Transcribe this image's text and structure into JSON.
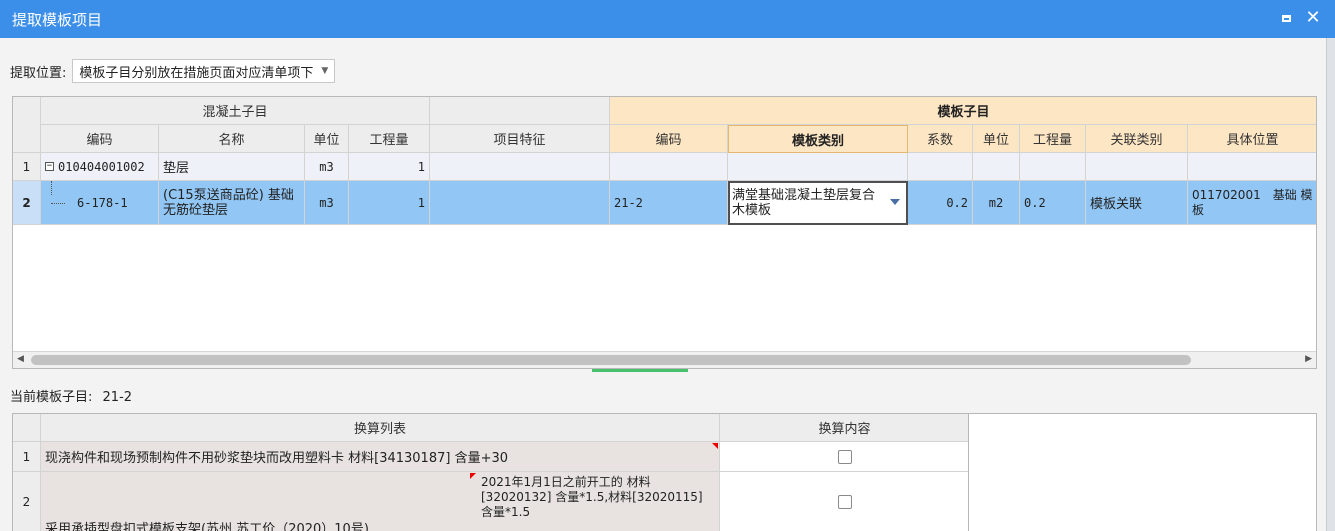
{
  "window": {
    "title": "提取模板项目"
  },
  "position": {
    "label": "提取位置:",
    "selected": "模板子目分别放在措施页面对应清单项下"
  },
  "top_grid": {
    "group_left": "混凝土子目",
    "group_right": "模板子目",
    "columns": {
      "left_code": "编码",
      "left_name": "名称",
      "left_unit": "单位",
      "left_qty": "工程量",
      "feature": "项目特征",
      "right_code": "编码",
      "template_type": "模板类别",
      "coef": "系数",
      "right_unit": "单位",
      "right_qty": "工程量",
      "assoc_type": "关联类别",
      "location": "具体位置"
    },
    "rows": [
      {
        "num": "1",
        "code": "010404001002",
        "name": "垫层",
        "unit": "m3",
        "qty": "1",
        "feature": "",
        "r_code": "",
        "template_type": "",
        "coef": "",
        "r_unit": "",
        "r_qty": "",
        "assoc": "",
        "location": ""
      },
      {
        "num": "2",
        "code": "6-178-1",
        "name": "(C15泵送商品砼) 基础无筋砼垫层",
        "unit": "m3",
        "qty": "1",
        "feature": "",
        "r_code": "21-2",
        "template_type": "满堂基础混凝土垫层复合木模板",
        "coef": "0.2",
        "r_unit": "m2",
        "r_qty": "0.2",
        "assoc": "模板关联",
        "location": "011702001　基础 模板"
      }
    ]
  },
  "current": {
    "label": "当前模板子目:",
    "value": "21-2"
  },
  "bottom_grid": {
    "columns": {
      "list": "换算列表",
      "content": "换算内容"
    },
    "rows": [
      {
        "num": "1",
        "text": "现浇构件和现场预制构件不用砂浆垫块而改用塑料卡 材料[34130187] 含量+30",
        "note": "",
        "checked": false
      },
      {
        "num": "2",
        "text": "采用承插型盘扣式模板支架(苏州 苏工价（2020）10号)",
        "note": "2021年1月1日之前开工的 材料[32020132] 含量*1.5,材料[32020115] 含量*1.5",
        "checked": false
      }
    ]
  }
}
